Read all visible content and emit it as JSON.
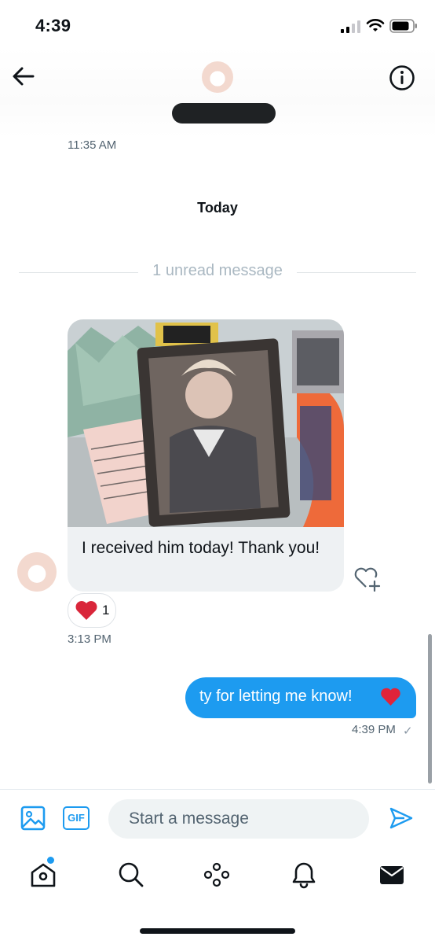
{
  "status_bar": {
    "time": "4:39"
  },
  "conversation": {
    "messages": [
      {
        "direction": "received",
        "timestamp": "11:35 AM"
      }
    ],
    "date_separator": "Today",
    "unread_divider": "1 unread message",
    "received": {
      "text": "I received him today! Thank you!",
      "reaction": {
        "emoji": "heart",
        "count": "1"
      },
      "timestamp": "3:13 PM"
    },
    "sent": {
      "text": "ty for letting me know!",
      "emoji": "red-heart",
      "timestamp": "4:39 PM",
      "status_mark": "✓"
    }
  },
  "composer": {
    "placeholder": "Start a message",
    "gif_label": "GIF"
  },
  "nav": {
    "items": [
      {
        "icon": "home-icon",
        "badge": true
      },
      {
        "icon": "search-icon"
      },
      {
        "icon": "spaces-icon"
      },
      {
        "icon": "notifications-icon"
      },
      {
        "icon": "messages-icon",
        "active": true
      }
    ]
  },
  "colors": {
    "accent": "#1d9bf0",
    "text": "#0f1419",
    "muted": "#536471",
    "heart": "#f4212e"
  }
}
